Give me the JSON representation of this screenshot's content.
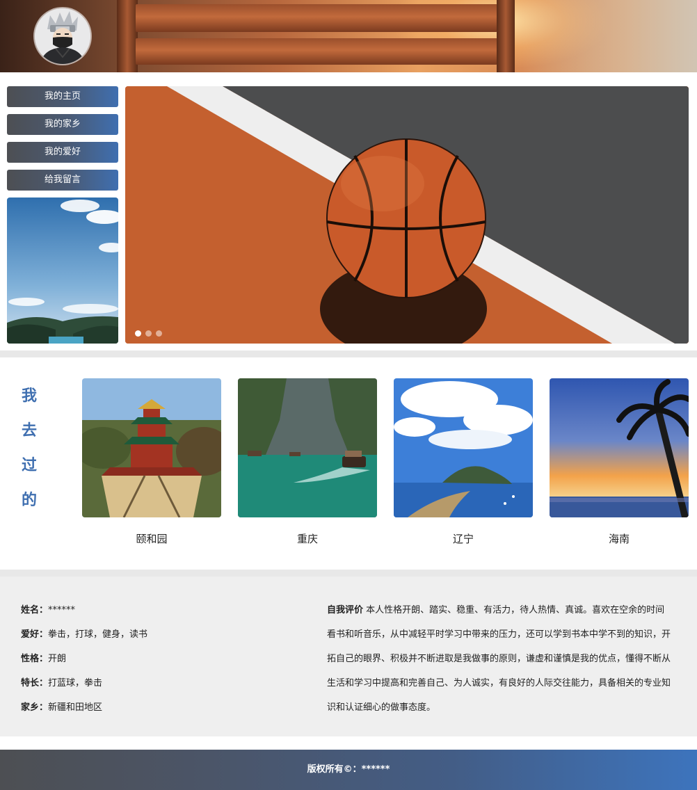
{
  "header": {
    "avatar_alt": "avatar"
  },
  "nav": {
    "items": [
      {
        "label": "我的主页"
      },
      {
        "label": "我的家乡"
      },
      {
        "label": "我的爱好"
      },
      {
        "label": "给我留言"
      }
    ]
  },
  "slider": {
    "slide_count": 3,
    "active_index": 0
  },
  "places": {
    "title_chars": [
      "我",
      "去",
      "过",
      "的"
    ],
    "items": [
      {
        "caption": "颐和园"
      },
      {
        "caption": "重庆"
      },
      {
        "caption": "辽宁"
      },
      {
        "caption": "海南"
      }
    ]
  },
  "profile": {
    "name_label": "姓名",
    "name_value": "******",
    "hobby_label": "爱好",
    "hobby_value": "拳击，打球，健身，读书",
    "character_label": "性格",
    "character_value": "开朗",
    "skill_label": "特长",
    "skill_value": "打蓝球，拳击",
    "hometown_label": "家乡",
    "hometown_value": "新疆和田地区",
    "self_eval_label": "自我评价",
    "self_eval_text": "本人性格开朗、踏实、稳重、有活力，待人热情、真诚。喜欢在空余的时间看书和听音乐，从中减轻平时学习中带来的压力，还可以学到书本中学不到的知识，开拓自己的眼界、积极并不断进取是我做事的原则，谦虚和谨慎是我的优点，懂得不断从生活和学习中提高和完善自己、为人诚实，有良好的人际交往能力，具备相关的专业知识和认证细心的做事态度。"
  },
  "footer": {
    "copyright": "版权所有©：******"
  },
  "colors": {
    "accent": "#3f6fb0",
    "nav_dark": "#4d4f53",
    "info_bg": "#efefef",
    "separator": "#e8e8e8"
  }
}
